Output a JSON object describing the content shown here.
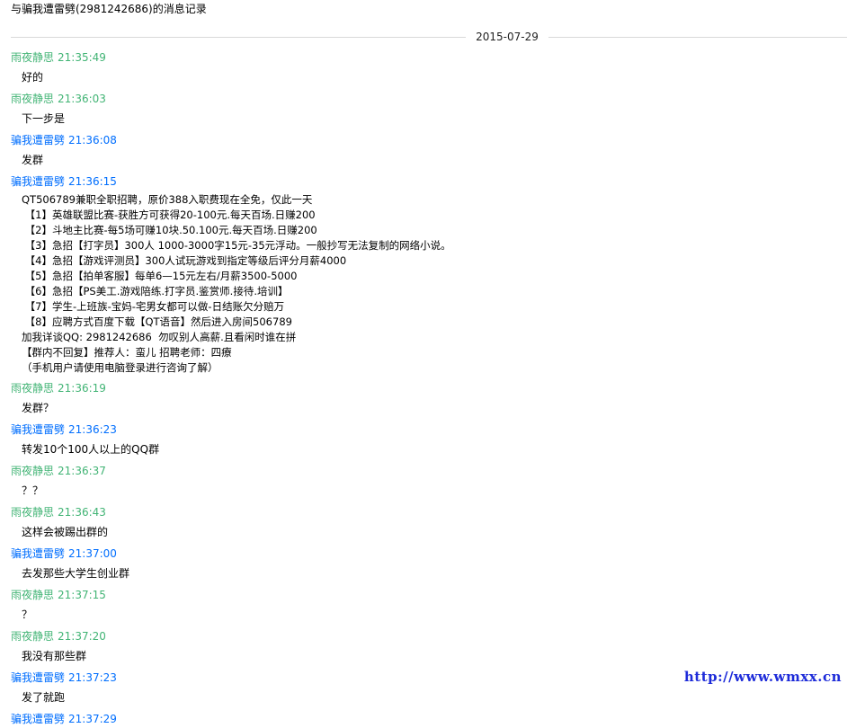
{
  "window": {
    "title": "与骗我遭雷劈(2981242686)的消息记录"
  },
  "date_separator": "2015-07-29",
  "colors": {
    "sender_a": "#42b475",
    "sender_b": "#006efe",
    "watermark": "#1d2bd9"
  },
  "messages": [
    {
      "sender": "雨夜静思",
      "time": "21:35:49",
      "color": "green",
      "lines": [
        "好的"
      ]
    },
    {
      "sender": "雨夜静思",
      "time": "21:36:03",
      "color": "green",
      "lines": [
        "下一步是"
      ]
    },
    {
      "sender": "骗我遭雷劈",
      "time": "21:36:08",
      "color": "blue",
      "lines": [
        "发群"
      ]
    },
    {
      "sender": "骗我遭雷劈",
      "time": "21:36:15",
      "color": "blue",
      "ad": true,
      "lines": [
        "QT506789兼职全职招聘，原价388入职费现在全免，仅此一天",
        " 【1】英雄联盟比赛-获胜方可获得20-100元.每天百场.日赚200",
        " 【2】斗地主比赛-每5场可赚10块.50.100元.每天百场.日赚200",
        " 【3】急招【打字员】300人 1000-3000字15元-35元浮动。一般抄写无法复制的网络小说。",
        " 【4】急招【游戏评测员】300人试玩游戏到指定等级后评分月薪4000",
        " 【5】急招【拍单客服】每单6—15元左右/月薪3500-5000",
        " 【6】急招【PS美工.游戏陪练.打字员.鉴赏师.接待.培训】",
        " 【7】学生-上班族-宝妈-宅男女都可以做-日结账欠分赔万",
        " 【8】应聘方式百度下载【QT语音】然后进入房间506789",
        "加我详谈QQ: 2981242686  勿叹别人高薪.且看闲时谁在拼",
        "【群内不回复】推荐人：蛮儿 招聘老师：四療",
        "（手机用户请使用电脑登录进行咨询了解）"
      ]
    },
    {
      "sender": "雨夜静思",
      "time": "21:36:19",
      "color": "green",
      "lines": [
        "发群？"
      ]
    },
    {
      "sender": "骗我遭雷劈",
      "time": "21:36:23",
      "color": "blue",
      "lines": [
        "转发10个100人以上的QQ群"
      ]
    },
    {
      "sender": "雨夜静思",
      "time": "21:36:37",
      "color": "green",
      "lines": [
        "？？"
      ]
    },
    {
      "sender": "雨夜静思",
      "time": "21:36:43",
      "color": "green",
      "lines": [
        "这样会被踢出群的"
      ]
    },
    {
      "sender": "骗我遭雷劈",
      "time": "21:37:00",
      "color": "blue",
      "lines": [
        "去发那些大学生创业群"
      ]
    },
    {
      "sender": "雨夜静思",
      "time": "21:37:15",
      "color": "green",
      "lines": [
        "？"
      ]
    },
    {
      "sender": "雨夜静思",
      "time": "21:37:20",
      "color": "green",
      "lines": [
        "我没有那些群"
      ]
    },
    {
      "sender": "骗我遭雷劈",
      "time": "21:37:23",
      "color": "blue",
      "lines": [
        "发了就跑"
      ]
    },
    {
      "sender": "骗我遭雷劈",
      "time": "21:37:29",
      "color": "blue",
      "lines": []
    }
  ],
  "watermark": "http://www.wmxx.cn"
}
